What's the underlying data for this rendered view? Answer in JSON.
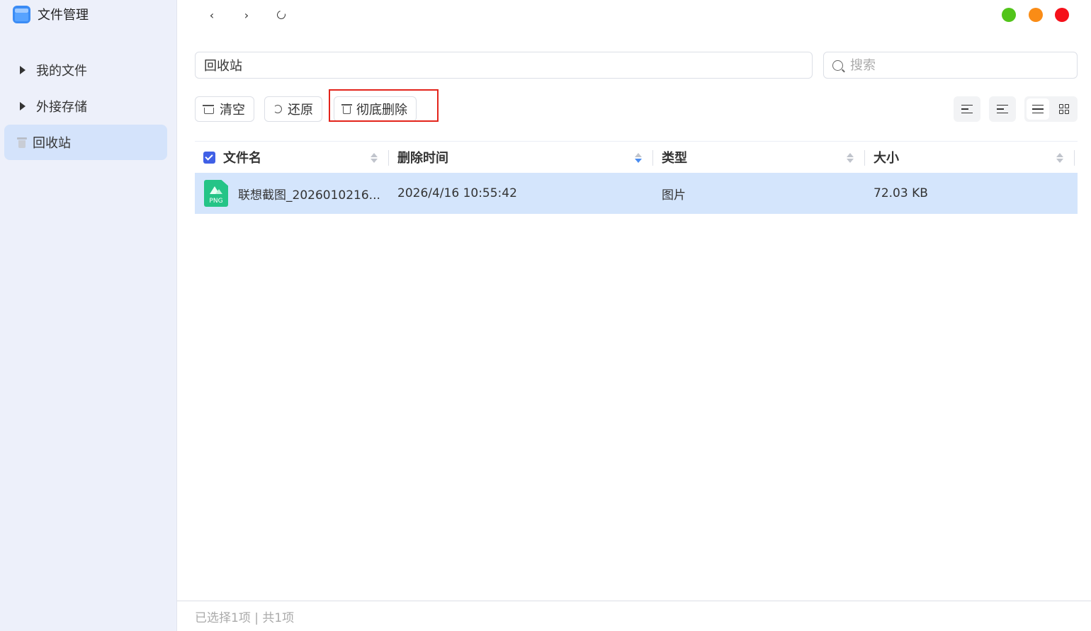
{
  "app": {
    "title": "文件管理"
  },
  "sidebar": {
    "items": [
      {
        "label": "我的文件"
      },
      {
        "label": "外接存储"
      },
      {
        "label": "回收站"
      }
    ]
  },
  "pathbar": {
    "path": "回收站"
  },
  "search": {
    "placeholder": "搜索"
  },
  "toolbar": {
    "clear_label": "清空",
    "restore_label": "还原",
    "delete_permanently_label": "彻底删除"
  },
  "table": {
    "columns": [
      "文件名",
      "删除时间",
      "类型",
      "大小"
    ],
    "rows": [
      {
        "icon_label": "PNG",
        "name": "联想截图_2026010216...",
        "deleted_time": "2026/4/16 10:55:42",
        "type": "图片",
        "size": "72.03 KB"
      }
    ]
  },
  "status": {
    "text": "已选择1项 | 共1项"
  },
  "colors": {
    "accent": "#4060e6",
    "selected_row": "#d4e5fc",
    "highlight_box": "#e3241b",
    "green": "#52c41a",
    "orange": "#fa8c16",
    "red": "#f5101a"
  }
}
